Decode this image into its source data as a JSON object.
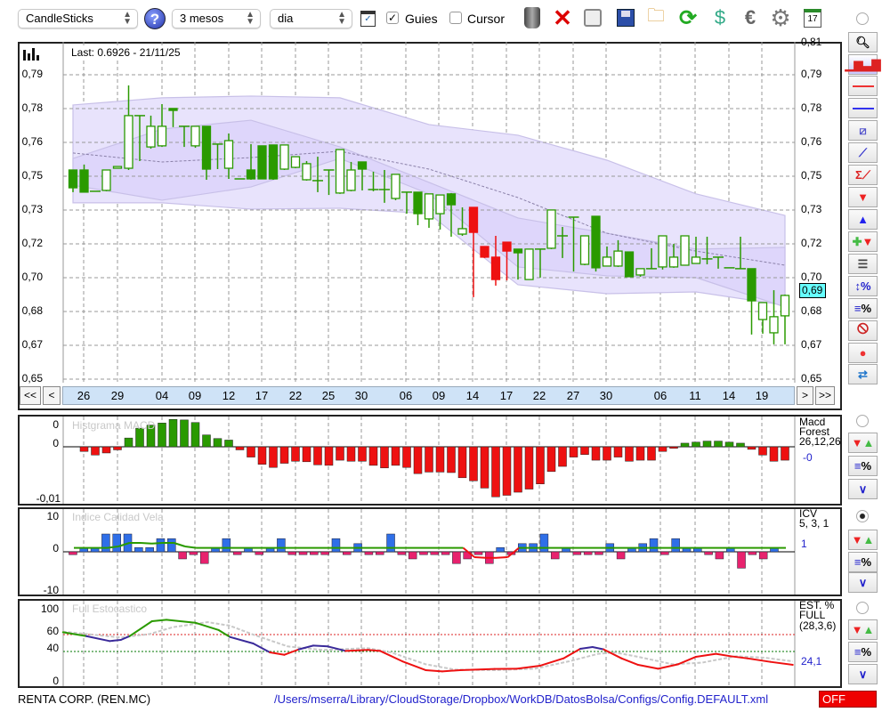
{
  "toolbar": {
    "chart_type": "CandleSticks",
    "period": "3 mesos",
    "interval": "dia",
    "guides_label": "Guies",
    "guides_checked": true,
    "cursor_label": "Cursor",
    "cursor_checked": false,
    "help_icon": "?",
    "calendar_day": "17"
  },
  "main": {
    "last_label": "Last: 0.6926 - 21/11/25",
    "y_labels": [
      "0,79",
      "0,78",
      "0,76",
      "0,75",
      "0,73",
      "0,72",
      "0,70",
      "0,68",
      "0,67",
      "0,65"
    ],
    "y_top_cut": "0,81",
    "last_value_badge": "0,69",
    "dates": [
      "26",
      "29",
      "04",
      "09",
      "12",
      "17",
      "22",
      "25",
      "30",
      "06",
      "09",
      "14",
      "17",
      "22",
      "27",
      "30",
      "06",
      "11",
      "14",
      "19"
    ],
    "nav": {
      "first": "<<",
      "prev": "<",
      "next": ">",
      "last": ">>"
    }
  },
  "macd": {
    "title": "Histgrama MACD",
    "label1": "Macd",
    "label2": "Forest",
    "params": "26,12,26",
    "value": "-0",
    "y_labels": [
      "0",
      "0",
      "-0,01"
    ]
  },
  "icv": {
    "title": "Indice Calidad Vela",
    "label1": "ICV",
    "params": "5, 3, 1",
    "value": "1",
    "y_labels": [
      "10",
      "0",
      "-10"
    ]
  },
  "stoch": {
    "title": "Full Estocastico",
    "label1": "EST. %",
    "label2": "FULL",
    "params": "(28,3,6)",
    "value": "24,1",
    "y_labels": [
      "100",
      "60",
      "40",
      "0"
    ]
  },
  "footer": {
    "symbol": "RENTA CORP. (REN.MC)",
    "path": "/Users/mserra/Library/CloudStorage/Dropbox/WorkDB/DatosBolsa/Configs/Config.DEFAULT.xml",
    "status": "OFF"
  },
  "colors": {
    "up_green": "#2a9a00",
    "down_red": "#ee1111",
    "band": "#e8e3fc",
    "band_inner": "#ded6fb",
    "icv_pos": "#2f6fe8",
    "icv_neg": "#e8226e",
    "stoch_blue": "#3a2a9a",
    "date_strip": "#cfe3f7"
  },
  "chart_data": [
    {
      "type": "candlestick",
      "title": "CandleSticks",
      "ylim": [
        0.65,
        0.79
      ],
      "candles": [
        [
          0.7462,
          0.7462,
          0.736,
          0.738,
          "f"
        ],
        [
          0.7462,
          0.7487,
          0.736,
          0.736,
          "f"
        ],
        [
          0.7364,
          0.7364,
          0.7364,
          0.7364,
          "h"
        ],
        [
          0.7368,
          0.7462,
          0.7364,
          0.7462,
          "h"
        ],
        [
          0.747,
          0.7478,
          0.747,
          0.7478,
          "h"
        ],
        [
          0.747,
          0.7851,
          0.7462,
          0.7712,
          "h"
        ],
        [
          0.7712,
          0.7712,
          0.7503,
          0.7712,
          "h"
        ],
        [
          0.7568,
          0.7712,
          0.756,
          0.7663,
          "h"
        ],
        [
          0.7573,
          0.7765,
          0.7568,
          0.7663,
          "h"
        ],
        [
          0.7745,
          0.7745,
          0.7659,
          0.7736,
          "f"
        ],
        [
          0.7663,
          0.7663,
          0.7568,
          0.7663,
          "h"
        ],
        [
          0.7573,
          0.7663,
          0.7564,
          0.7663,
          "h"
        ],
        [
          0.7663,
          0.7663,
          0.7417,
          0.7466,
          "f"
        ],
        [
          0.7581,
          0.7581,
          0.7466,
          0.7581,
          "h"
        ],
        [
          0.747,
          0.763,
          0.7421,
          0.7597,
          "h"
        ],
        [
          0.7421,
          0.7421,
          0.7421,
          0.7421,
          "h"
        ],
        [
          0.7462,
          0.7581,
          0.7417,
          0.7421,
          "f"
        ],
        [
          0.7573,
          0.7573,
          0.7421,
          0.7421,
          "f"
        ],
        [
          0.7577,
          0.7577,
          0.7417,
          0.7421,
          "f"
        ],
        [
          0.7466,
          0.7577,
          0.7462,
          0.7577,
          "h"
        ],
        [
          0.7474,
          0.7523,
          0.747,
          0.7523,
          "h"
        ],
        [
          0.7417,
          0.7503,
          0.7413,
          0.7491,
          "h"
        ],
        [
          0.7413,
          0.7523,
          0.736,
          0.7413,
          "h"
        ],
        [
          0.7462,
          0.7462,
          0.7347,
          0.7462,
          "h"
        ],
        [
          0.7356,
          0.7556,
          0.7352,
          0.7556,
          "h"
        ],
        [
          0.7368,
          0.7499,
          0.7364,
          0.7462,
          "h"
        ],
        [
          0.7499,
          0.7499,
          0.7368,
          0.7466,
          "f"
        ],
        [
          0.7372,
          0.7454,
          0.7364,
          0.7372,
          "h"
        ],
        [
          0.7372,
          0.7462,
          0.7311,
          0.7372,
          "h"
        ],
        [
          0.7331,
          0.7442,
          0.7323,
          0.7442,
          "h"
        ],
        [
          0.736,
          0.736,
          0.7261,
          0.736,
          "h"
        ],
        [
          0.736,
          0.736,
          0.7208,
          0.7261,
          "f"
        ],
        [
          0.7237,
          0.7352,
          0.7196,
          0.7352,
          "h"
        ],
        [
          0.7261,
          0.7347,
          0.7188,
          0.7347,
          "h"
        ],
        [
          0.7352,
          0.7356,
          0.7155,
          0.7302,
          "f"
        ],
        [
          0.7167,
          0.729,
          0.7159,
          0.7192,
          "h"
        ],
        [
          0.729,
          0.729,
          0.6877,
          0.7175,
          "r"
        ],
        [
          0.711,
          0.711,
          0.7057,
          0.7061,
          "r"
        ],
        [
          0.7061,
          0.7159,
          0.693,
          0.6958,
          "r"
        ],
        [
          0.713,
          0.713,
          0.6954,
          0.7089,
          "r"
        ],
        [
          0.7098,
          0.7098,
          0.6958,
          0.7081,
          "f"
        ],
        [
          0.6958,
          0.7098,
          0.6958,
          0.7098,
          "h"
        ],
        [
          0.7098,
          0.7098,
          0.6967,
          0.7098,
          "h"
        ],
        [
          0.7102,
          0.7278,
          0.7098,
          0.7278,
          "h"
        ],
        [
          0.7159,
          0.72,
          0.7057,
          0.7159,
          "h"
        ],
        [
          0.7245,
          0.7245,
          0.6995,
          0.7245,
          "h"
        ],
        [
          0.7028,
          0.7159,
          0.7024,
          0.7159,
          "h"
        ],
        [
          0.7249,
          0.7249,
          0.6995,
          0.7012,
          "f"
        ],
        [
          0.702,
          0.711,
          0.702,
          0.7061,
          "h"
        ],
        [
          0.702,
          0.7139,
          0.7016,
          0.7089,
          "h"
        ],
        [
          0.7085,
          0.7085,
          0.6971,
          0.6971,
          "f"
        ],
        [
          0.6979,
          0.7008,
          0.6971,
          0.7008,
          "h"
        ],
        [
          0.7008,
          0.7102,
          0.7008,
          0.7008,
          "h"
        ],
        [
          0.7016,
          0.7159,
          0.7004,
          0.7159,
          "h"
        ],
        [
          0.7016,
          0.7122,
          0.7012,
          0.7061,
          "h"
        ],
        [
          0.7024,
          0.7159,
          0.7024,
          0.7159,
          "h"
        ],
        [
          0.7032,
          0.7155,
          0.7032,
          0.7061,
          "h"
        ],
        [
          0.7053,
          0.7155,
          0.7028,
          0.7053,
          "h"
        ],
        [
          0.7061,
          0.7061,
          0.7008,
          0.7061,
          "h"
        ],
        [
          0.7012,
          0.7012,
          0.7012,
          0.7012,
          "h"
        ],
        [
          0.7008,
          0.7155,
          0.7008,
          0.7008,
          "h"
        ],
        [
          0.7008,
          0.7008,
          0.6705,
          0.686,
          "f"
        ],
        [
          0.6774,
          0.6852,
          0.6709,
          0.6852,
          "h"
        ],
        [
          0.6713,
          0.6909,
          0.666,
          0.6787,
          "h"
        ],
        [
          0.6791,
          0.6889,
          0.666,
          0.6885,
          "h"
        ]
      ],
      "bands_index": [
        0,
        8,
        16,
        24,
        32,
        40,
        48,
        56,
        64
      ],
      "band_outer_upper": [
        0.7761,
        0.7794,
        0.7802,
        0.7794,
        0.7671,
        0.7622,
        0.7507,
        0.7352,
        0.7253
      ],
      "band_inner_upper": [
        0.7515,
        0.765,
        0.7691,
        0.7568,
        0.7405,
        0.7241,
        0.7171,
        0.7098,
        0.7106
      ],
      "band_middle": [
        0.754,
        0.7499,
        0.7519,
        0.7548,
        0.7466,
        0.7335,
        0.7171,
        0.7089,
        0.7024
      ],
      "band_inner_lower": [
        0.7392,
        0.7323,
        0.7384,
        0.7515,
        0.7352,
        0.7016,
        0.6975,
        0.6967,
        0.6832
      ],
      "band_outer_lower": [
        0.7311,
        0.7311,
        0.7282,
        0.7286,
        0.7261,
        0.6934,
        0.6893,
        0.6901,
        0.684
      ]
    },
    {
      "type": "bar",
      "title": "Histgrama MACD",
      "start_index": 1,
      "values": [
        -0.0009,
        -0.0016,
        -0.0012,
        -0.0006,
        0.0017,
        0.0036,
        0.0042,
        0.0046,
        0.0053,
        0.0052,
        0.0047,
        0.0023,
        0.0016,
        0.0013,
        -0.0006,
        -0.002,
        -0.0034,
        -0.004,
        -0.0032,
        -0.0028,
        -0.0029,
        -0.0035,
        -0.0036,
        -0.0026,
        -0.0028,
        -0.0028,
        -0.0036,
        -0.0041,
        -0.0036,
        -0.004,
        -0.0052,
        -0.0049,
        -0.0049,
        -0.005,
        -0.006,
        -0.0066,
        -0.008,
        -0.0097,
        -0.0094,
        -0.0088,
        -0.0082,
        -0.0072,
        -0.0048,
        -0.0038,
        -0.002,
        -0.0015,
        -0.0026,
        -0.0026,
        -0.002,
        -0.0028,
        -0.0026,
        -0.0026,
        -0.0009,
        -0.0003,
        0.0007,
        0.0009,
        0.0011,
        0.0011,
        0.0009,
        0.0007,
        -0.0005,
        -0.0016,
        -0.0028,
        -0.0026
      ]
    },
    {
      "type": "bar",
      "title": "Indice Calidad Vela",
      "ylim": [
        -10,
        10
      ],
      "values": [
        -0.8,
        1,
        1,
        5,
        5,
        5,
        1.2,
        1.2,
        3.7,
        3.7,
        -2,
        -0.8,
        -3.3,
        1,
        3.7,
        -0.8,
        1,
        -0.8,
        1,
        3.7,
        -0.8,
        -0.8,
        -0.8,
        -0.8,
        3.7,
        -0.8,
        2.3,
        -0.8,
        -0.8,
        5,
        -0.8,
        -2,
        -0.8,
        -0.8,
        -0.8,
        -3.3,
        -2,
        -0.8,
        -3.3,
        1.2,
        -0.8,
        2.3,
        2.3,
        5,
        -2,
        1,
        -0.8,
        -0.8,
        -0.8,
        2.3,
        -2,
        1,
        2.3,
        3.7,
        -0.8,
        3.7,
        1,
        1,
        -0.8,
        -2,
        1,
        -4.6,
        -0.8,
        -2,
        1
      ],
      "signal": [
        1.1,
        1.1,
        1.1,
        1.1,
        1.5,
        2.5,
        2.5,
        2.3,
        2.5,
        2.5,
        1.5,
        1.1,
        1.1,
        1.1,
        1.1,
        1.1,
        1.1,
        1.1,
        1.1,
        1.1,
        1.1,
        1.1,
        1.1,
        1.1,
        1.1,
        1.1,
        1.1,
        1.1,
        1.1,
        1.1,
        1.1,
        1.1,
        1.1,
        1.1,
        1.1,
        1.1,
        -1.5,
        -1.7,
        -1.7,
        -1.5,
        1.1,
        1.1,
        1.1,
        1.1,
        1.1,
        1.1,
        1.1,
        1.1,
        1.1,
        1.1,
        1.1,
        1.1,
        1.1,
        1.1,
        1.1,
        1.1,
        1.1,
        1.1,
        1.1,
        1.1,
        1.1,
        1.1,
        1.1,
        1.1,
        1.1
      ]
    },
    {
      "type": "line",
      "title": "Full Estocastico",
      "ylim": [
        0,
        100
      ],
      "levels": [
        60,
        40
      ],
      "k": [
        [
          -0.9,
          62.8
        ],
        [
          1.2,
          58.2
        ],
        [
          3.3,
          52.3
        ],
        [
          4.3,
          53.7
        ],
        [
          5.1,
          58.2
        ],
        [
          7.1,
          75.8
        ],
        [
          8.4,
          77.5
        ],
        [
          11.0,
          74.0
        ],
        [
          13.1,
          65.3
        ],
        [
          14.1,
          57.2
        ],
        [
          16.2,
          49.5
        ],
        [
          17.7,
          38.9
        ],
        [
          19.0,
          36.1
        ],
        [
          20.3,
          42.5
        ],
        [
          21.6,
          47.0
        ],
        [
          22.9,
          46.0
        ],
        [
          24.5,
          40.7
        ],
        [
          26.5,
          41.8
        ],
        [
          27.6,
          40.7
        ],
        [
          29.6,
          28.4
        ],
        [
          31.7,
          17.9
        ],
        [
          33.2,
          16.5
        ],
        [
          34.8,
          17.9
        ],
        [
          37.9,
          19.3
        ],
        [
          39.9,
          19.6
        ],
        [
          42.0,
          23.2
        ],
        [
          44.1,
          31.9
        ],
        [
          45.6,
          43.2
        ],
        [
          46.7,
          45.3
        ],
        [
          47.7,
          42.5
        ],
        [
          49.3,
          31.9
        ],
        [
          50.8,
          24.2
        ],
        [
          52.6,
          19.6
        ],
        [
          54.4,
          24.9
        ],
        [
          56.0,
          33.7
        ],
        [
          57.8,
          37.2
        ],
        [
          59.1,
          34.4
        ],
        [
          60.6,
          31.9
        ],
        [
          62.7,
          27.7
        ],
        [
          64.7,
          24.2
        ]
      ],
      "d": [
        [
          -0.9,
          63.5
        ],
        [
          1.7,
          60.0
        ],
        [
          4.3,
          56.5
        ],
        [
          6.9,
          60.7
        ],
        [
          9.0,
          68.8
        ],
        [
          12.1,
          74.7
        ],
        [
          14.1,
          70.5
        ],
        [
          16.2,
          60.0
        ],
        [
          19.3,
          46.0
        ],
        [
          22.4,
          41.8
        ],
        [
          26.5,
          43.9
        ],
        [
          28.6,
          38.9
        ],
        [
          31.7,
          24.9
        ],
        [
          34.3,
          18.6
        ],
        [
          37.9,
          17.9
        ],
        [
          41.5,
          19.6
        ],
        [
          44.6,
          28.4
        ],
        [
          47.2,
          37.2
        ],
        [
          48.7,
          38.9
        ],
        [
          50.8,
          33.7
        ],
        [
          53.9,
          24.9
        ],
        [
          56.5,
          26.7
        ],
        [
          59.6,
          34.4
        ],
        [
          62.2,
          32.6
        ],
        [
          64.7,
          28.4
        ]
      ]
    }
  ]
}
